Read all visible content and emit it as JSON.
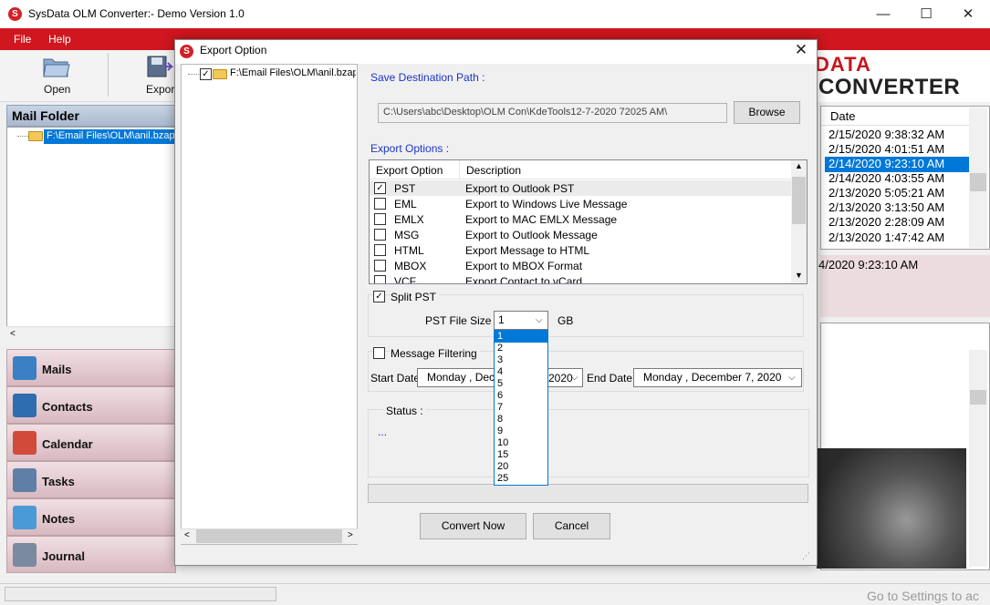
{
  "app": {
    "title": "SysData OLM Converter:- Demo Version 1.0",
    "logo_letter": "S",
    "brand_line1": "DATA",
    "brand_line2": "CONVERTER"
  },
  "window_controls": {
    "minimize": "—",
    "maximize": "☐",
    "close": "✕"
  },
  "menu": {
    "items": [
      {
        "label": "File",
        "key": "F"
      },
      {
        "label": "Help",
        "key": "H"
      }
    ]
  },
  "toolbar": {
    "open_label": "Open",
    "export_label": "Export"
  },
  "mail_folder": {
    "header": "Mail Folder",
    "node_label": "F:\\Email Files\\OLM\\anil.bzapp"
  },
  "nav": [
    {
      "label": "Mails",
      "icon": "mail-icon",
      "color": "#3b7fc4"
    },
    {
      "label": "Contacts",
      "icon": "contacts-icon",
      "color": "#2e6db0"
    },
    {
      "label": "Calendar",
      "icon": "calendar-icon",
      "color": "#d24b3a"
    },
    {
      "label": "Tasks",
      "icon": "tasks-icon",
      "color": "#5f7fa6"
    },
    {
      "label": "Notes",
      "icon": "notes-icon",
      "color": "#4a9ad8"
    },
    {
      "label": "Journal",
      "icon": "journal-icon",
      "color": "#7a8aa0"
    }
  ],
  "mail_list": {
    "date_header": "Date",
    "dates": [
      "2/15/2020 9:38:32 AM",
      "2/15/2020 4:01:51 AM",
      "2/14/2020 9:23:10 AM",
      "2/14/2020 4:03:55 AM",
      "2/13/2020 5:05:21 AM",
      "2/13/2020 3:13:50 AM",
      "2/13/2020 2:28:09 AM",
      "2/13/2020 1:47:42 AM"
    ],
    "selected_index": 2,
    "preview_date": "4/2020 9:23:10 AM"
  },
  "dialog": {
    "title": "Export Option",
    "close": "✕",
    "tree_node": "F:\\Email Files\\OLM\\anil.bzap",
    "save_destination_label": "Save Destination Path :",
    "path_value": "C:\\Users\\abc\\Desktop\\OLM Con\\KdeTools12-7-2020 72025 AM\\",
    "browse_label": "Browse",
    "export_options_label": "Export Options :",
    "table_headers": {
      "option": "Export Option",
      "description": "Description"
    },
    "options": [
      {
        "name": "PST",
        "desc": "Export to Outlook PST",
        "checked": true
      },
      {
        "name": "EML",
        "desc": "Export to Windows Live Message",
        "checked": false
      },
      {
        "name": "EMLX",
        "desc": "Export to MAC EMLX Message",
        "checked": false
      },
      {
        "name": "MSG",
        "desc": "Export to Outlook Message",
        "checked": false
      },
      {
        "name": "HTML",
        "desc": "Export Message to HTML",
        "checked": false
      },
      {
        "name": "MBOX",
        "desc": "Export to MBOX Format",
        "checked": false
      },
      {
        "name": "VCF",
        "desc": "Export Contact to vCard",
        "checked": false
      }
    ],
    "split_pst_label": "Split PST",
    "split_pst_checked": true,
    "pst_file_size_label": "PST File Size :",
    "pst_size_value": "1",
    "pst_size_unit": "GB",
    "size_options": [
      "1",
      "2",
      "3",
      "4",
      "5",
      "6",
      "7",
      "8",
      "9",
      "10",
      "15",
      "20",
      "25"
    ],
    "message_filtering_label": "Message Filtering",
    "message_filtering_checked": false,
    "start_date_label": "Start Date",
    "start_date_value": "Monday    ,  Dec",
    "start_date_tail": "2020",
    "end_date_label": "End Date",
    "end_date_value": "Monday    , December    7, 2020",
    "status_label": "Status :",
    "status_value": "...",
    "convert_label": "Convert Now",
    "cancel_label": "Cancel"
  },
  "status_bar": {
    "watermark": "Go to Settings to ac"
  }
}
